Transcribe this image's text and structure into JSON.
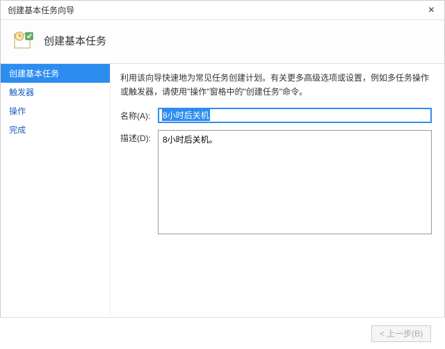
{
  "window": {
    "title": "创建基本任务向导",
    "close_symbol": "×"
  },
  "header": {
    "title": "创建基本任务"
  },
  "sidebar": {
    "steps": [
      {
        "label": "创建基本任务",
        "active": true
      },
      {
        "label": "触发器",
        "active": false
      },
      {
        "label": "操作",
        "active": false
      },
      {
        "label": "完成",
        "active": false
      }
    ]
  },
  "main": {
    "instruction": "利用该向导快速地为常见任务创建计划。有关更多高级选项或设置，例如多任务操作或触发器，请使用\"操作\"窗格中的\"创建任务\"命令。",
    "name_label": "名称(A):",
    "name_value": "8小时后关机",
    "desc_label": "描述(D):",
    "desc_value": "8小时后关机。"
  },
  "footer": {
    "back_label": "< 上一步(B)"
  }
}
